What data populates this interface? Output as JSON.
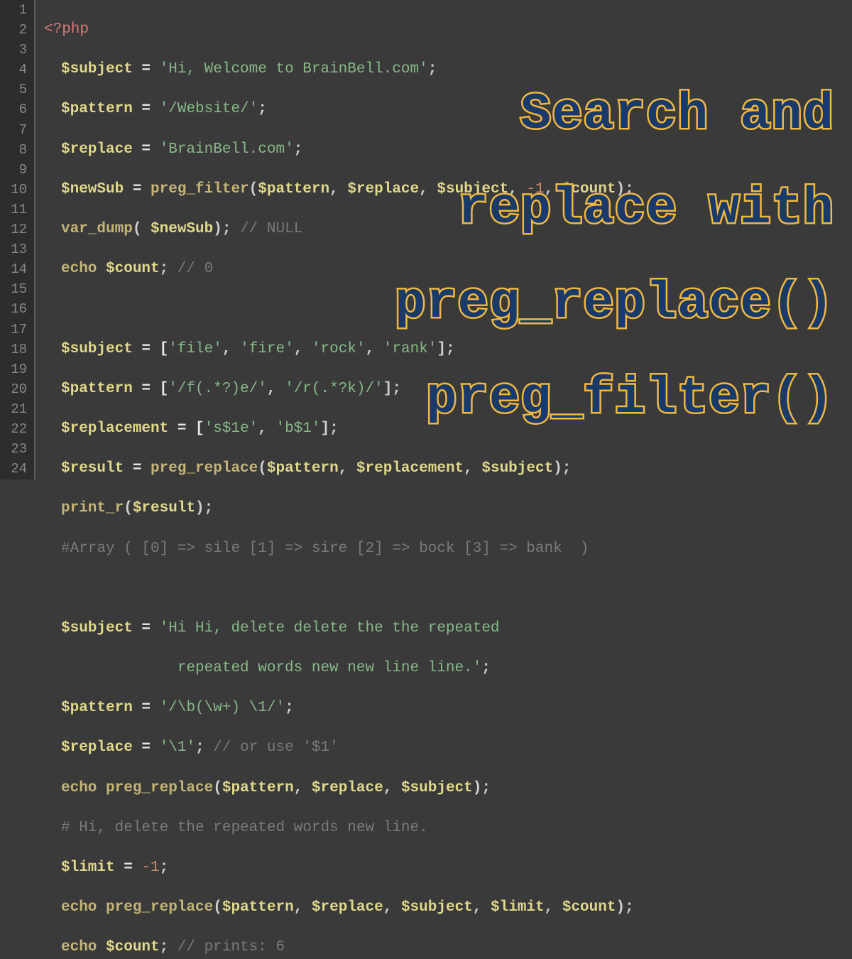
{
  "lineNumbers": [
    "1",
    "2",
    "3",
    "4",
    "5",
    "6",
    "7",
    "8",
    "9",
    "10",
    "11",
    "12",
    "13",
    "14",
    "15",
    "16",
    "17",
    "18",
    "19",
    "20",
    "21",
    "22",
    "23",
    "24"
  ],
  "code": {
    "l1": {
      "open": "<?php"
    },
    "l2": {
      "v": "$subject",
      "eq": " = ",
      "s": "'Hi, Welcome to BrainBell.com'",
      "end": ";"
    },
    "l3": {
      "v": "$pattern",
      "eq": " = ",
      "s": "'/Website/'",
      "end": ";"
    },
    "l4": {
      "v": "$replace",
      "eq": " = ",
      "s": "'BrainBell.com'",
      "end": ";"
    },
    "l5": {
      "v": "$newSub",
      "eq": " = ",
      "fn": "preg_filter",
      "p1": "(",
      "a1": "$pattern",
      "c1": ", ",
      "a2": "$replace",
      "c2": ", ",
      "a3": "$subject",
      "c3": ", ",
      "n": "-1",
      "c4": ", ",
      "a4": "$count",
      "p2": ");"
    },
    "l6": {
      "fn": "var_dump",
      "p1": "( ",
      "a1": "$newSub",
      "p2": "); ",
      "cm": "// NULL"
    },
    "l7": {
      "kw": "echo ",
      "v": "$count",
      "end": "; ",
      "cm": "// 0"
    },
    "l9": {
      "v": "$subject",
      "eq": " = [",
      "s1": "'file'",
      "c1": ", ",
      "s2": "'fire'",
      "c2": ", ",
      "s3": "'rock'",
      "c3": ", ",
      "s4": "'rank'",
      "end": "];"
    },
    "l10": {
      "v": "$pattern",
      "eq": " = [",
      "s1": "'/f(.*?)e/'",
      "c1": ", ",
      "s2": "'/r(.*?k)/'",
      "end": "];"
    },
    "l11": {
      "v": "$replacement",
      "eq": " = [",
      "s1": "'s$1e'",
      "c1": ", ",
      "s2": "'b$1'",
      "end": "];"
    },
    "l12": {
      "v": "$result",
      "eq": " = ",
      "fn": "preg_replace",
      "p1": "(",
      "a1": "$pattern",
      "c1": ", ",
      "a2": "$replacement",
      "c2": ", ",
      "a3": "$subject",
      "p2": ");"
    },
    "l13": {
      "fn": "print_r",
      "p1": "(",
      "a1": "$result",
      "p2": ");"
    },
    "l14": {
      "cm": "#Array ( [0] => sile [1] => sire [2] => bock [3] => bank  )"
    },
    "l16": {
      "v": "$subject",
      "eq": " = ",
      "s": "'Hi Hi, delete delete the the repeated"
    },
    "l17": {
      "s": "             repeated words new new line line.'",
      "end": ";"
    },
    "l18": {
      "v": "$pattern",
      "eq": " = ",
      "s": "'/\\b(\\w+) \\1/'",
      "end": ";"
    },
    "l19": {
      "v": "$replace",
      "eq": " = ",
      "s": "'\\1'",
      "end": "; ",
      "cm": "// or use '$1'"
    },
    "l20": {
      "kw": "echo ",
      "fn": "preg_replace",
      "p1": "(",
      "a1": "$pattern",
      "c1": ", ",
      "a2": "$replace",
      "c2": ", ",
      "a3": "$subject",
      "p2": ");"
    },
    "l21": {
      "cm": "# Hi, delete the repeated words new line."
    },
    "l22": {
      "v": "$limit",
      "eq": " = ",
      "n": "-1",
      "end": ";"
    },
    "l23": {
      "kw": "echo ",
      "fn": "preg_replace",
      "p1": "(",
      "a1": "$pattern",
      "c1": ", ",
      "a2": "$replace",
      "c2": ", ",
      "a3": "$subject",
      "c3": ", ",
      "a4": "$limit",
      "c4": ", ",
      "a5": "$count",
      "p2": ");"
    },
    "l24": {
      "kw": "echo ",
      "v": "$count",
      "end": "; ",
      "cm": "// prints: 6"
    }
  },
  "overlay": {
    "line1": "Search and",
    "line2": "replace with",
    "line3": "preg_replace()",
    "line4": "preg_filter()"
  }
}
